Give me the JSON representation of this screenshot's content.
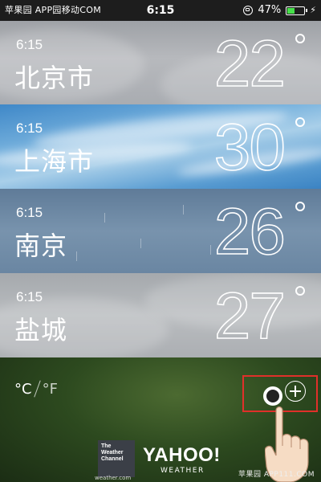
{
  "status_bar": {
    "carrier": "苹果园 APP园移动COM",
    "time": "6:15",
    "battery_percent": "47%",
    "battery_level": 0.47,
    "battery_color": "#46e04a",
    "icons": [
      "rotation-lock-icon",
      "battery-icon",
      "charging-bolt-icon"
    ]
  },
  "cities": [
    {
      "time": "6:15",
      "name": "北京市",
      "temp": "22",
      "weather": "overcast"
    },
    {
      "time": "6:15",
      "name": "上海市",
      "temp": "30",
      "weather": "clear-blue-sky"
    },
    {
      "time": "6:15",
      "name": "南京",
      "temp": "26",
      "weather": "rain"
    },
    {
      "time": "6:15",
      "name": "盐城",
      "temp": "27",
      "weather": "cloudy"
    }
  ],
  "bottom": {
    "unit_c": "°C",
    "unit_f": "°F",
    "add_button_icon": "plus-circle-icon",
    "highlight_color": "#e0302a",
    "twc_lines": [
      "The",
      "Weather",
      "Channel"
    ],
    "twc_sub": "weather.com",
    "yahoo_main": "YAHOO!",
    "yahoo_sub": "WEATHER",
    "watermark": "苹果园 APP111.COM"
  }
}
